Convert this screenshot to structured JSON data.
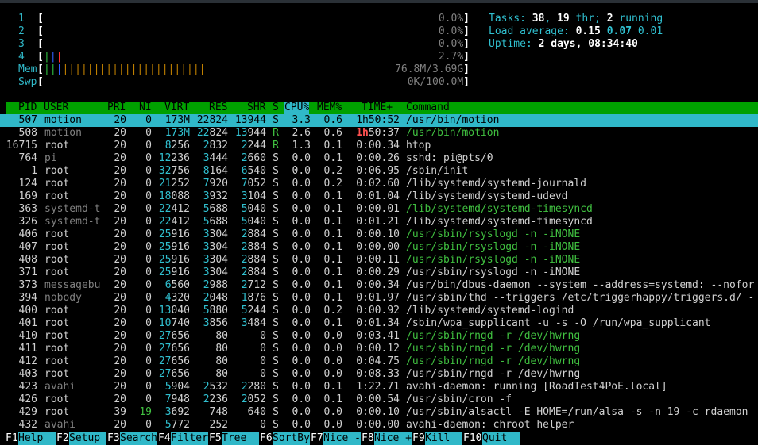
{
  "meters": [
    {
      "label": "1",
      "value": "0.0%]",
      "bars": []
    },
    {
      "label": "2",
      "value": "0.0%]",
      "bars": []
    },
    {
      "label": "3",
      "value": "0.0%]",
      "bars": []
    },
    {
      "label": "4",
      "value": "2.7%]",
      "bars": [
        {
          "text": "|",
          "color": "#30c040"
        },
        {
          "text": "|",
          "color": "#3060ff"
        },
        {
          "text": "|",
          "color": "#ff3030"
        }
      ]
    },
    {
      "label": "Mem",
      "value": "76.8M/3.69G]",
      "bars": [
        {
          "text": "||",
          "color": "#30c040"
        },
        {
          "text": "|",
          "color": "#3060ff"
        },
        {
          "text": "|||||||||||||||||||||||",
          "color": "#c08000"
        }
      ]
    },
    {
      "label": "Swp",
      "value": "0K/100.0M]",
      "bars": []
    }
  ],
  "stats": {
    "tasks_label": "Tasks: ",
    "tasks": "38",
    "sep1": ", ",
    "thr": "19",
    "thr_label": " thr; ",
    "running": "2",
    "running_label": " running",
    "load_label": "Load average: ",
    "load1": "0.15",
    "load5": "0.07",
    "load15": "0.01",
    "uptime_label": "Uptime: ",
    "uptime": "2 days, 08:34:40"
  },
  "columns": {
    "pid": "PID",
    "user": "USER",
    "pri": "PRI",
    "ni": "NI",
    "virt": "VIRT",
    "res": "RES",
    "shr": "SHR",
    "s": "S",
    "cpu": "CPU%",
    "mem": "MEM%",
    "time": "TIME+",
    "cmd": "Command"
  },
  "processes": [
    {
      "pid": "507",
      "user": "motion",
      "pri": "20",
      "ni": "0",
      "virt": "173M",
      "res": "22824",
      "shr": "13944",
      "s": "S",
      "cpu": "3.3",
      "mem": "0.6",
      "time": "1h50:52",
      "cmd": "/usr/bin/motion",
      "selected": true
    },
    {
      "pid": "508",
      "user": "motion",
      "pri": "20",
      "ni": "0",
      "virt": "173M",
      "res": "22824",
      "shr": "13944",
      "s": "R",
      "cpu": "2.6",
      "mem": "0.6",
      "time": "1h50:37",
      "cmd": "/usr/bin/motion",
      "thread": true,
      "grayuser": true
    },
    {
      "pid": "16715",
      "user": "root",
      "pri": "20",
      "ni": "0",
      "virt": "8256",
      "res": "2832",
      "shr": "2244",
      "s": "R",
      "cpu": "1.3",
      "mem": "0.1",
      "time": "0:00.34",
      "cmd": "htop"
    },
    {
      "pid": "764",
      "user": "pi",
      "pri": "20",
      "ni": "0",
      "virt": "12236",
      "res": "3444",
      "shr": "2660",
      "s": "S",
      "cpu": "0.0",
      "mem": "0.1",
      "time": "0:00.26",
      "cmd": "sshd: pi@pts/0",
      "grayuser": true
    },
    {
      "pid": "1",
      "user": "root",
      "pri": "20",
      "ni": "0",
      "virt": "32756",
      "res": "8164",
      "shr": "6540",
      "s": "S",
      "cpu": "0.0",
      "mem": "0.2",
      "time": "0:06.95",
      "cmd": "/sbin/init"
    },
    {
      "pid": "124",
      "user": "root",
      "pri": "20",
      "ni": "0",
      "virt": "21252",
      "res": "7920",
      "shr": "7052",
      "s": "S",
      "cpu": "0.0",
      "mem": "0.2",
      "time": "0:02.60",
      "cmd": "/lib/systemd/systemd-journald"
    },
    {
      "pid": "169",
      "user": "root",
      "pri": "20",
      "ni": "0",
      "virt": "18088",
      "res": "3932",
      "shr": "3104",
      "s": "S",
      "cpu": "0.0",
      "mem": "0.1",
      "time": "0:01.04",
      "cmd": "/lib/systemd/systemd-udevd"
    },
    {
      "pid": "363",
      "user": "systemd-t",
      "pri": "20",
      "ni": "0",
      "virt": "22412",
      "res": "5688",
      "shr": "5040",
      "s": "S",
      "cpu": "0.0",
      "mem": "0.1",
      "time": "0:00.01",
      "cmd": "/lib/systemd/systemd-timesyncd",
      "thread": true,
      "grayuser": true
    },
    {
      "pid": "326",
      "user": "systemd-t",
      "pri": "20",
      "ni": "0",
      "virt": "22412",
      "res": "5688",
      "shr": "5040",
      "s": "S",
      "cpu": "0.0",
      "mem": "0.1",
      "time": "0:01.21",
      "cmd": "/lib/systemd/systemd-timesyncd",
      "grayuser": true
    },
    {
      "pid": "406",
      "user": "root",
      "pri": "20",
      "ni": "0",
      "virt": "25916",
      "res": "3304",
      "shr": "2884",
      "s": "S",
      "cpu": "0.0",
      "mem": "0.1",
      "time": "0:00.10",
      "cmd": "/usr/sbin/rsyslogd -n -iNONE",
      "thread": true
    },
    {
      "pid": "407",
      "user": "root",
      "pri": "20",
      "ni": "0",
      "virt": "25916",
      "res": "3304",
      "shr": "2884",
      "s": "S",
      "cpu": "0.0",
      "mem": "0.1",
      "time": "0:00.00",
      "cmd": "/usr/sbin/rsyslogd -n -iNONE",
      "thread": true
    },
    {
      "pid": "408",
      "user": "root",
      "pri": "20",
      "ni": "0",
      "virt": "25916",
      "res": "3304",
      "shr": "2884",
      "s": "S",
      "cpu": "0.0",
      "mem": "0.1",
      "time": "0:00.11",
      "cmd": "/usr/sbin/rsyslogd -n -iNONE",
      "thread": true
    },
    {
      "pid": "371",
      "user": "root",
      "pri": "20",
      "ni": "0",
      "virt": "25916",
      "res": "3304",
      "shr": "2884",
      "s": "S",
      "cpu": "0.0",
      "mem": "0.1",
      "time": "0:00.29",
      "cmd": "/usr/sbin/rsyslogd -n -iNONE"
    },
    {
      "pid": "373",
      "user": "messagebu",
      "pri": "20",
      "ni": "0",
      "virt": "6560",
      "res": "2988",
      "shr": "2712",
      "s": "S",
      "cpu": "0.0",
      "mem": "0.1",
      "time": "0:00.34",
      "cmd": "/usr/bin/dbus-daemon --system --address=systemd: --nofor",
      "grayuser": true
    },
    {
      "pid": "394",
      "user": "nobody",
      "pri": "20",
      "ni": "0",
      "virt": "4320",
      "res": "2048",
      "shr": "1876",
      "s": "S",
      "cpu": "0.0",
      "mem": "0.1",
      "time": "0:01.97",
      "cmd": "/usr/sbin/thd --triggers /etc/triggerhappy/triggers.d/ -",
      "grayuser": true
    },
    {
      "pid": "400",
      "user": "root",
      "pri": "20",
      "ni": "0",
      "virt": "13040",
      "res": "5880",
      "shr": "5244",
      "s": "S",
      "cpu": "0.0",
      "mem": "0.2",
      "time": "0:00.92",
      "cmd": "/lib/systemd/systemd-logind"
    },
    {
      "pid": "401",
      "user": "root",
      "pri": "20",
      "ni": "0",
      "virt": "10740",
      "res": "3856",
      "shr": "3484",
      "s": "S",
      "cpu": "0.0",
      "mem": "0.1",
      "time": "0:01.34",
      "cmd": "/sbin/wpa_supplicant -u -s -O /run/wpa_supplicant"
    },
    {
      "pid": "410",
      "user": "root",
      "pri": "20",
      "ni": "0",
      "virt": "27656",
      "res": "80",
      "shr": "0",
      "s": "S",
      "cpu": "0.0",
      "mem": "0.0",
      "time": "0:03.41",
      "cmd": "/usr/sbin/rngd -r /dev/hwrng",
      "thread": true
    },
    {
      "pid": "411",
      "user": "root",
      "pri": "20",
      "ni": "0",
      "virt": "27656",
      "res": "80",
      "shr": "0",
      "s": "S",
      "cpu": "0.0",
      "mem": "0.0",
      "time": "0:00.12",
      "cmd": "/usr/sbin/rngd -r /dev/hwrng",
      "thread": true
    },
    {
      "pid": "412",
      "user": "root",
      "pri": "20",
      "ni": "0",
      "virt": "27656",
      "res": "80",
      "shr": "0",
      "s": "S",
      "cpu": "0.0",
      "mem": "0.0",
      "time": "0:04.75",
      "cmd": "/usr/sbin/rngd -r /dev/hwrng",
      "thread": true
    },
    {
      "pid": "403",
      "user": "root",
      "pri": "20",
      "ni": "0",
      "virt": "27656",
      "res": "80",
      "shr": "0",
      "s": "S",
      "cpu": "0.0",
      "mem": "0.0",
      "time": "0:08.33",
      "cmd": "/usr/sbin/rngd -r /dev/hwrng"
    },
    {
      "pid": "423",
      "user": "avahi",
      "pri": "20",
      "ni": "0",
      "virt": "5904",
      "res": "2532",
      "shr": "2280",
      "s": "S",
      "cpu": "0.0",
      "mem": "0.1",
      "time": "1:22.71",
      "cmd": "avahi-daemon: running [RoadTest4PoE.local]",
      "grayuser": true
    },
    {
      "pid": "426",
      "user": "root",
      "pri": "20",
      "ni": "0",
      "virt": "7948",
      "res": "2236",
      "shr": "2052",
      "s": "S",
      "cpu": "0.0",
      "mem": "0.1",
      "time": "0:00.54",
      "cmd": "/usr/sbin/cron -f"
    },
    {
      "pid": "429",
      "user": "root",
      "pri": "39",
      "ni": "19",
      "virt": "3692",
      "res": "748",
      "shr": "640",
      "s": "S",
      "cpu": "0.0",
      "mem": "0.0",
      "time": "0:00.10",
      "cmd": "/usr/sbin/alsactl -E HOME=/run/alsa -s -n 19 -c rdaemon",
      "niceval": true
    },
    {
      "pid": "432",
      "user": "avahi",
      "pri": "20",
      "ni": "0",
      "virt": "5772",
      "res": "252",
      "shr": "0",
      "s": "S",
      "cpu": "0.0",
      "mem": "0.0",
      "time": "0:00.00",
      "cmd": "avahi-daemon: chroot helper",
      "grayuser": true
    }
  ],
  "footer": [
    {
      "key": "F1",
      "label": "Help  "
    },
    {
      "key": "F2",
      "label": "Setup "
    },
    {
      "key": "F3",
      "label": "Search"
    },
    {
      "key": "F4",
      "label": "Filter"
    },
    {
      "key": "F5",
      "label": "Tree  "
    },
    {
      "key": "F6",
      "label": "SortBy"
    },
    {
      "key": "F7",
      "label": "Nice -"
    },
    {
      "key": "F8",
      "label": "Nice +"
    },
    {
      "key": "F9",
      "label": "Kill  "
    },
    {
      "key": "F10",
      "label": "Quit  "
    }
  ]
}
